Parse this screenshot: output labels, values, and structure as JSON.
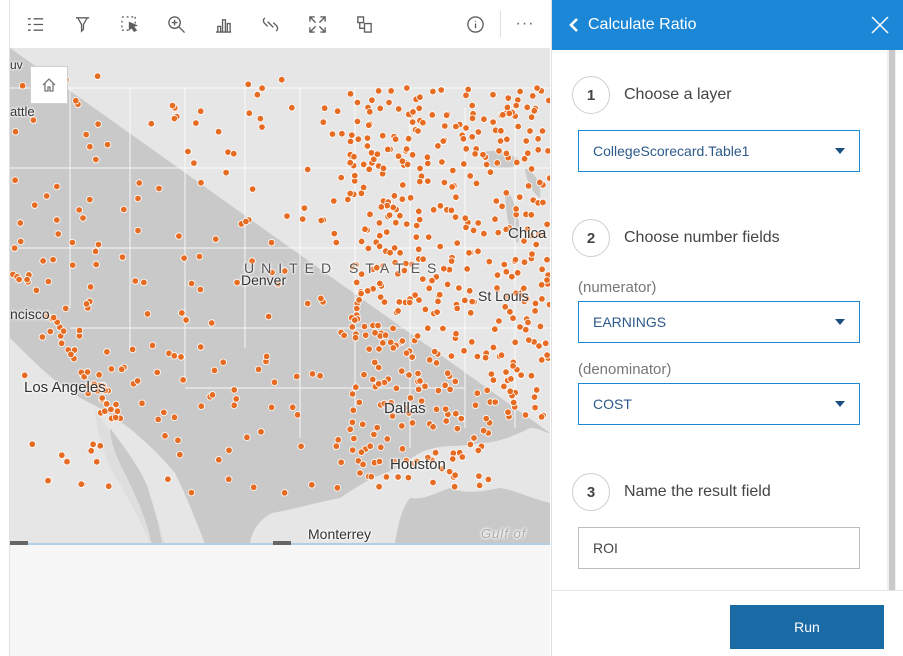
{
  "toolbar": {
    "buttons": [
      {
        "name": "legend-list-icon",
        "glyph": "list"
      },
      {
        "name": "filter-icon",
        "glyph": "funnel"
      },
      {
        "name": "selection-icon",
        "glyph": "select"
      },
      {
        "name": "zoom-icon",
        "glyph": "magnifier"
      },
      {
        "name": "bar-chart-icon",
        "glyph": "bars"
      },
      {
        "name": "link-icon",
        "glyph": "chain"
      },
      {
        "name": "fullscreen-icon",
        "glyph": "expand"
      },
      {
        "name": "visualization-type-icon",
        "glyph": "shapes"
      }
    ],
    "info_icon": "info-icon",
    "more_glyph": "···"
  },
  "map": {
    "labels": {
      "seattle": "attle",
      "san_francisco": "ncisco",
      "los_angeles": "Los Angeles",
      "denver": "Denver",
      "united_states": "UNITED STATES",
      "st_louis": "St Louis",
      "chicago": "Chica",
      "dallas": "Dallas",
      "houston": "Houston",
      "monterrey": "Monterrey",
      "gulf": "Gulf of",
      "vancouver": "uv"
    },
    "point_color": "#e76c23",
    "land_color": "#e6e6e6",
    "water_color": "#c9c9c9"
  },
  "panel": {
    "title": "Calculate Ratio",
    "header_color": "#1b87d6",
    "step1": {
      "number": "1",
      "text": "Choose a layer",
      "layer_value": "CollegeScorecard.Table1"
    },
    "step2": {
      "number": "2",
      "text": "Choose number fields",
      "numerator_label": "(numerator)",
      "numerator_value": "EARNINGS",
      "denominator_label": "(denominator)",
      "denominator_value": "COST"
    },
    "step3": {
      "number": "3",
      "text": "Name the result field",
      "field_value": "ROI"
    },
    "run_label": "Run"
  }
}
